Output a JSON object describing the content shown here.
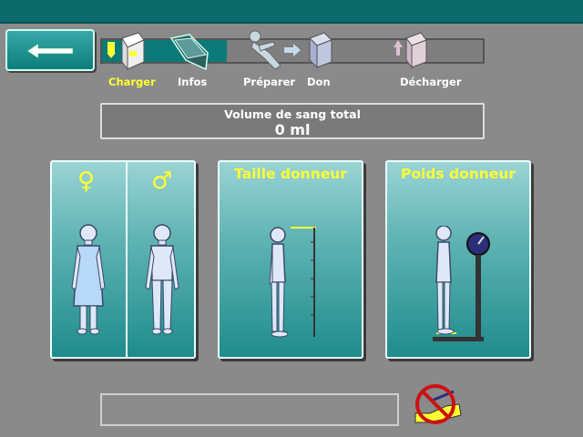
{
  "toolbar": {
    "back_icon": "return-arrow-icon"
  },
  "progress": {
    "filled_fraction": 0.33,
    "steps": [
      {
        "label": "Charger",
        "icon": "load-kit-icon",
        "active": true
      },
      {
        "label": "Infos",
        "icon": "info-folder-icon",
        "active": false
      },
      {
        "label": "Préparer",
        "icon": "prepare-donor-icon",
        "active": false
      },
      {
        "label": "Don",
        "icon": "donation-icon",
        "active": false
      },
      {
        "label": "Décharger",
        "icon": "unload-kit-icon",
        "active": false
      }
    ]
  },
  "volume": {
    "title": "Volume de sang total",
    "value": "0 ml"
  },
  "cards": {
    "gender": {
      "female_symbol": "♀",
      "male_symbol": "♂"
    },
    "height": {
      "title": "Taille donneur"
    },
    "weight": {
      "title": "Poids donneur"
    }
  },
  "status": {
    "message": ""
  },
  "colors": {
    "accent": "#ffff33",
    "teal": "#0d7a7a",
    "background": "#8a8a8a"
  }
}
